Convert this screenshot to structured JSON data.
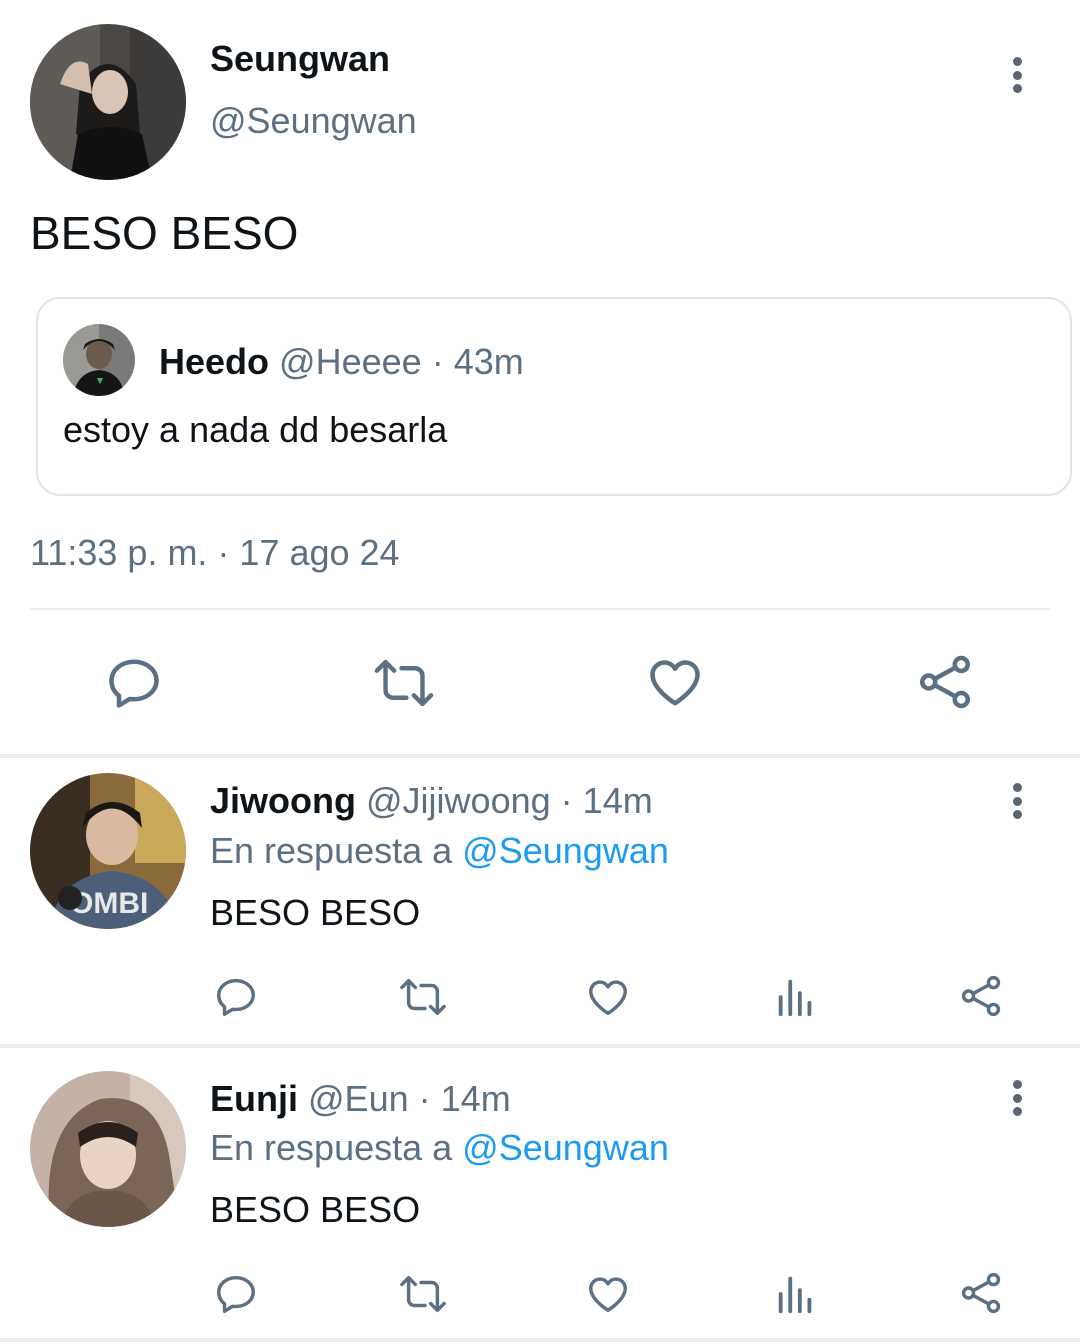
{
  "main_tweet": {
    "display_name": "Seungwan",
    "handle": "@Seungwan",
    "text": "BESO BESO",
    "timestamp": "11:33 p. m. · 17 ago 24",
    "quoted": {
      "display_name": "Heedo",
      "handle": "@Heeee",
      "separator": "·",
      "time": "43m",
      "text": "estoy a nada dd besarla"
    },
    "actions": [
      "reply-icon",
      "retweet-icon",
      "like-icon",
      "share-icon"
    ]
  },
  "replies": [
    {
      "display_name": "Jiwoong",
      "handle": "@Jijiwoong",
      "separator": "·",
      "time": "14m",
      "reply_prefix": "En respuesta a",
      "reply_to": "@Seungwan",
      "text": "BESO BESO",
      "actions": [
        "reply-icon",
        "retweet-icon",
        "like-icon",
        "analytics-icon",
        "share-icon"
      ]
    },
    {
      "display_name": "Eunji",
      "handle": "@Eun",
      "separator": "·",
      "time": "14m",
      "reply_prefix": "En respuesta a",
      "reply_to": "@Seungwan",
      "text": "BESO BESO",
      "actions": [
        "reply-icon",
        "retweet-icon",
        "like-icon",
        "analytics-icon",
        "share-icon"
      ]
    }
  ],
  "colors": {
    "icon": "#5b7083",
    "link": "#1d9bf0",
    "divider": "#e6ecf0",
    "text": "#0f1419"
  }
}
